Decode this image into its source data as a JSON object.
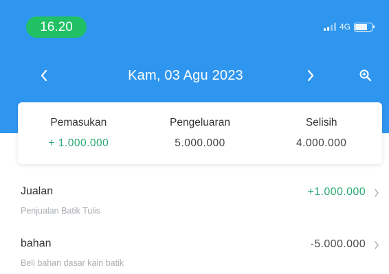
{
  "status_bar": {
    "time": "16.20",
    "network": "4G",
    "signal_icon": "signal-bars-icon",
    "battery_icon": "battery-icon",
    "battery_level": 0.75,
    "time_pill_color": "#22c065"
  },
  "header": {
    "date_label": "Kam, 03 Agu 2023",
    "prev_icon": "chevron-left-icon",
    "next_icon": "chevron-right-icon",
    "search_icon": "search-icon",
    "background_color": "#2f96ef"
  },
  "summary": {
    "income": {
      "label": "Pemasukan",
      "value": "+ 1.000.000"
    },
    "expense": {
      "label": "Pengeluaran",
      "value": "5.000.000"
    },
    "difference": {
      "label": "Selisih",
      "value": "4.000.000"
    },
    "income_color": "#2aa872"
  },
  "transactions": [
    {
      "title": "Jualan",
      "description": "Penjualan Batik Tulis",
      "amount": "+1.000.000",
      "type": "income",
      "chevron_icon": "chevron-right-icon"
    },
    {
      "title": "bahan",
      "description": "Beli bahan dasar kain batik",
      "amount": "-5.000.000",
      "type": "expense",
      "chevron_icon": "chevron-right-icon"
    }
  ]
}
